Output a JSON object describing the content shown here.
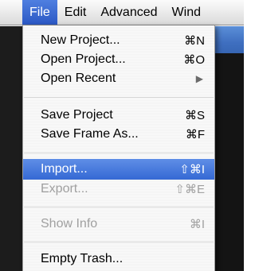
{
  "menubar": {
    "items": [
      "File",
      "Edit",
      "Advanced",
      "Wind"
    ]
  },
  "file_menu": {
    "new_project": {
      "label": "New Project...",
      "shortcut": "⌘N"
    },
    "open_project": {
      "label": "Open Project...",
      "shortcut": "⌘O"
    },
    "open_recent": {
      "label": "Open Recent",
      "arrow": "▶"
    },
    "save_project": {
      "label": "Save Project",
      "shortcut": "⌘S"
    },
    "save_frame_as": {
      "label": "Save Frame As...",
      "shortcut": "⌘F"
    },
    "import": {
      "label": "Import...",
      "shortcut": "⇧⌘I"
    },
    "export": {
      "label": "Export...",
      "shortcut": "⇧⌘E"
    },
    "show_info": {
      "label": "Show Info",
      "shortcut": "⌘I"
    },
    "empty_trash": {
      "label": "Empty Trash..."
    }
  },
  "colors": {
    "highlight": "#3569d4",
    "disabled_text": "#a0a0a0",
    "menu_bg": "#fbfbfb"
  }
}
